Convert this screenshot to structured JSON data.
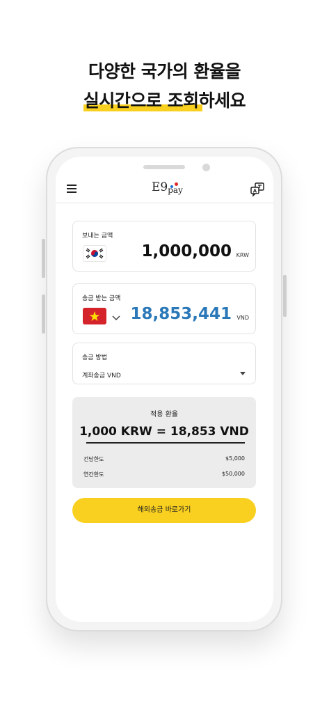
{
  "headline": {
    "line1": "다양한 국가의 환율을",
    "line2": "실시간으로 조회하세요"
  },
  "app": {
    "logo_main": "E9",
    "logo_sub": "pay",
    "send": {
      "label": "보내는 금액",
      "amount": "1,000,000",
      "currency": "KRW"
    },
    "receive": {
      "label": "송금 받는 금액",
      "amount": "18,853,441",
      "currency": "VND"
    },
    "method": {
      "label": "송금 방법",
      "value": "계좌송금 VND"
    },
    "rate": {
      "title": "적용 환율",
      "value": "1,000 KRW = 18,853 VND",
      "per_tx_label": "건당한도",
      "per_tx_value": "$5,000",
      "annual_label": "연간한도",
      "annual_value": "$50,000"
    },
    "cta_label": "해외송금 바로가기"
  },
  "colors": {
    "accent_yellow": "#f9d01f",
    "amount_blue": "#2a78b8"
  },
  "icons": [
    "menu-icon",
    "language-icon",
    "korea-flag-icon",
    "vietnam-flag-icon",
    "chevron-down-icon",
    "dropdown-caret-icon"
  ]
}
